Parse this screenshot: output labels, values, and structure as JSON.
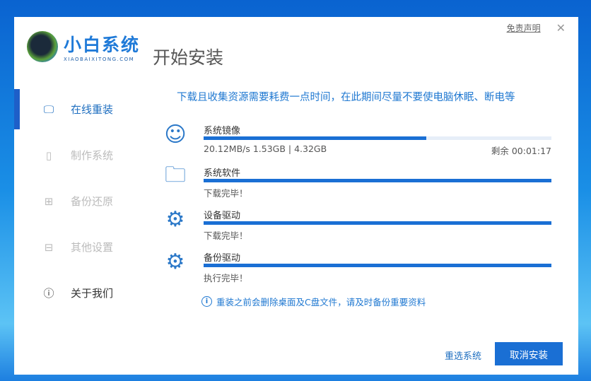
{
  "brand": {
    "name_cn": "小白系统",
    "name_en": "XIAOBAIXITONG.COM"
  },
  "header": {
    "title": "开始安装",
    "disclaimer": "免责声明",
    "close": "✕"
  },
  "sidebar": {
    "items": [
      {
        "label": "在线重装",
        "icon": "monitor-icon",
        "active": true
      },
      {
        "label": "制作系统",
        "icon": "usb-icon"
      },
      {
        "label": "备份还原",
        "icon": "grid-icon"
      },
      {
        "label": "其他设置",
        "icon": "briefcase-icon"
      },
      {
        "label": "关于我们",
        "icon": "info-icon"
      }
    ]
  },
  "main": {
    "notice": "下载且收集资源需要耗费一点时间，在此期间尽量不要使电脑休眠、断电等",
    "tasks": [
      {
        "name": "系统镜像",
        "status": "20.12MB/s 1.53GB | 4.32GB",
        "remaining": "剩余 00:01:17",
        "progress": 64,
        "icon": "chat-bubble-icon"
      },
      {
        "name": "系统软件",
        "status": "下载完毕！",
        "progress": 100,
        "icon": "folder-apps-icon"
      },
      {
        "name": "设备驱动",
        "status": "下载完毕！",
        "progress": 100,
        "icon": "gear-icon"
      },
      {
        "name": "备份驱动",
        "status": "执行完毕！",
        "progress": 100,
        "icon": "gear-sync-icon"
      }
    ],
    "warning": "重装之前会删除桌面及C盘文件，请及时备份重要资料"
  },
  "footer": {
    "reselect": "重选系统",
    "cancel": "取消安装"
  },
  "colors": {
    "accent": "#1a6fd4"
  }
}
